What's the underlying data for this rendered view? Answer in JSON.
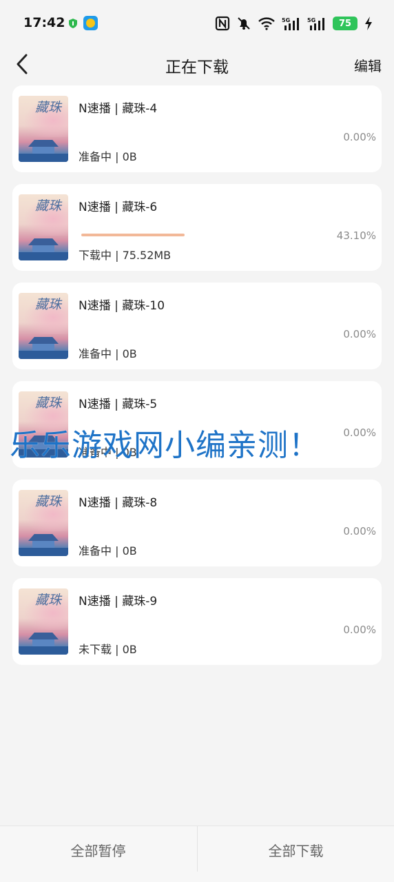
{
  "status_bar": {
    "time": "17:42",
    "battery": "75",
    "icons": [
      "shield-icon",
      "app-badge-icon",
      "nfc-icon",
      "mute-bell-icon",
      "wifi-icon",
      "signal-5g-icon",
      "signal-5g-icon",
      "battery-icon",
      "charging-icon"
    ],
    "network_label": "5G"
  },
  "header": {
    "title": "正在下载",
    "edit_label": "编辑"
  },
  "downloads": [
    {
      "name": "N速播 | 藏珠-4",
      "status": "准备中 | 0B",
      "percent": "0.00%",
      "progress": 0
    },
    {
      "name": "N速播 | 藏珠-6",
      "status": "下载中 | 75.52MB",
      "percent": "43.10%",
      "progress": 0.431
    },
    {
      "name": "N速播 | 藏珠-10",
      "status": "准备中 | 0B",
      "percent": "0.00%",
      "progress": 0
    },
    {
      "name": "N速播 | 藏珠-5",
      "status": "准备中 | 0B",
      "percent": "0.00%",
      "progress": 0
    },
    {
      "name": "N速播 | 藏珠-8",
      "status": "准备中 | 0B",
      "percent": "0.00%",
      "progress": 0
    },
    {
      "name": "N速播 | 藏珠-9",
      "status": "未下载 | 0B",
      "percent": "0.00%",
      "progress": 0
    }
  ],
  "cover_text": "藏珠",
  "watermark": "乐乐游戏网小编亲测！",
  "footer": {
    "pause_all_label": "全部暂停",
    "download_all_label": "全部下载"
  },
  "colors": {
    "progress_fill": "#f2b898",
    "battery": "#2fc45a",
    "watermark": "#1e73c7"
  }
}
